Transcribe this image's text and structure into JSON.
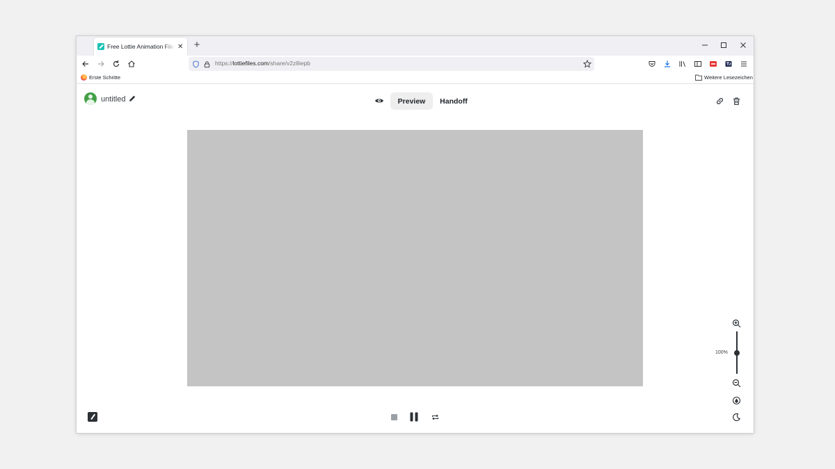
{
  "browser": {
    "tab_title": "Free Lottie Animation Files, Tools & Plugins",
    "tab_close": "✕",
    "new_tab": "+",
    "url_prefix": "https://",
    "url_host": "lottiefiles.com",
    "url_path": "/share/v2z8iepb",
    "bookmark_left": "Erste Schritte",
    "bookmark_right": "Weitere Lesezeichen"
  },
  "page": {
    "file_name": "untitled",
    "preview_label": "Preview",
    "handoff_label": "Handoff",
    "zoom_label": "100%",
    "zoom_level_percent": 100,
    "zoom_slider_fraction": 0.5,
    "canvas_color": "#c4c4c4"
  },
  "colors": {
    "accent": "#19c2b4",
    "icon_dark": "#2c3136",
    "preview_bg": "#eeeeee"
  },
  "icons": {
    "back": "arrow-left-icon",
    "forward": "arrow-right-icon",
    "reload": "reload-icon",
    "home": "home-icon",
    "shield": "shield-icon",
    "lock": "lock-icon",
    "star": "star-icon",
    "pocket": "pocket-icon",
    "download": "download-icon",
    "library": "library-icon",
    "sidebar": "sidebar-icon",
    "menu": "hamburger-menu-icon",
    "eye": "eye-icon",
    "link": "link-icon",
    "trash": "trash-icon",
    "zoom_in": "zoom-in-icon",
    "zoom_out": "zoom-out-icon",
    "background": "background-color-icon",
    "theme": "moon-icon",
    "stop": "stop-icon",
    "pause": "pause-icon",
    "loop": "loop-icon"
  }
}
